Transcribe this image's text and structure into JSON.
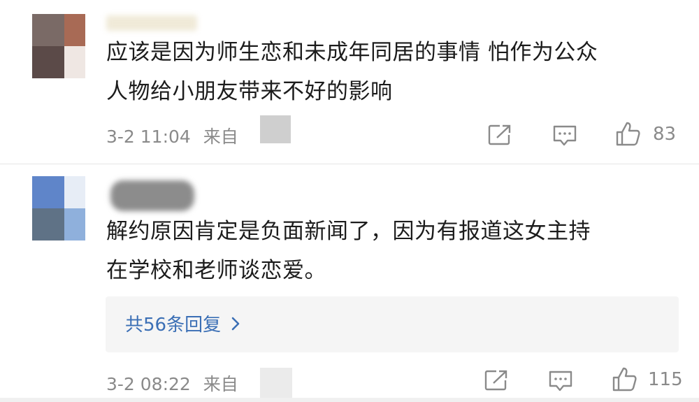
{
  "comments": [
    {
      "text_line1": "应该是因为师生恋和未成年同居的事情 怕作为公众",
      "text_line2": "人物给小朋友带来不好的影响",
      "time": "3-2 11:04",
      "source_prefix": "来自",
      "likes": "83",
      "icons": {
        "share": "share-icon",
        "comment": "comment-icon",
        "like": "thumbs-up-icon"
      }
    },
    {
      "text_line1": "解约原因肯定是负面新闻了，因为有报道这女主持",
      "text_line2": "在学校和老师谈恋爱。",
      "replies_label": "共56条回复",
      "time": "3-2 08:22",
      "source_prefix": "来自",
      "likes": "115",
      "icons": {
        "share": "share-icon",
        "comment": "comment-icon",
        "like": "thumbs-up-icon",
        "chevron": "chevron-right-icon"
      }
    }
  ],
  "colors": {
    "link": "#3b6fb5",
    "meta": "#8a8a8a",
    "reply_bg": "#f5f5f5"
  }
}
